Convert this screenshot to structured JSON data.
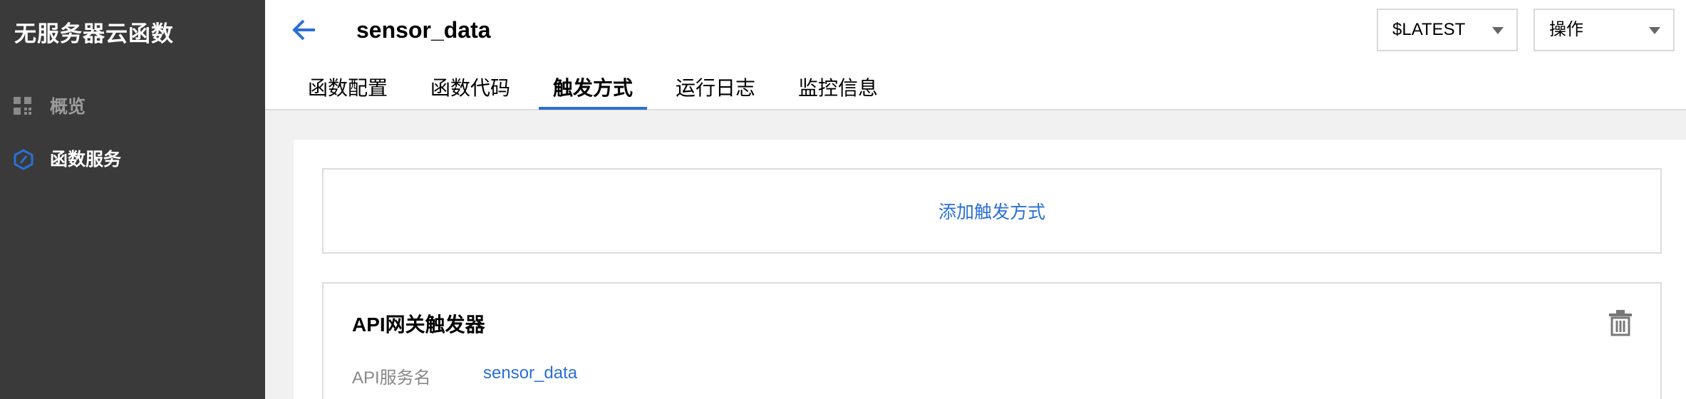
{
  "sidebar": {
    "app_title": "无服务器云函数",
    "items": [
      {
        "label": "概览",
        "icon": "grid-icon"
      },
      {
        "label": "函数服务",
        "icon": "function-hexagon-icon"
      }
    ]
  },
  "header": {
    "function_name": "sensor_data",
    "version_select": "$LATEST",
    "action_select": "操作",
    "tabs": [
      {
        "label": "函数配置"
      },
      {
        "label": "函数代码"
      },
      {
        "label": "触发方式"
      },
      {
        "label": "运行日志"
      },
      {
        "label": "监控信息"
      }
    ],
    "active_tab": "触发方式"
  },
  "main": {
    "add_trigger_label": "添加触发方式",
    "trigger": {
      "title": "API网关触发器",
      "fields": [
        {
          "label": "API服务名",
          "value": "sensor_data"
        }
      ]
    }
  },
  "colors": {
    "sidebar_bg": "#3a3a3a",
    "accent": "#2a6fd6",
    "page_bg": "#f1f1f1"
  }
}
